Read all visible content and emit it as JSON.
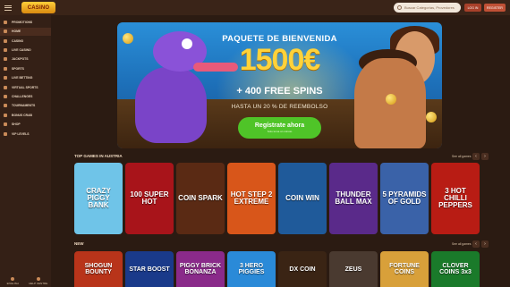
{
  "header": {
    "logo_text": "CASINO",
    "search_placeholder": "Buscar Categorías, Provedores",
    "login_label": "LOG IN",
    "register_label": "REGISTER"
  },
  "sidebar": {
    "items": [
      {
        "label": "PROMOTIONS",
        "icon": "gift-icon",
        "active": false
      },
      {
        "label": "HOME",
        "icon": "home-icon",
        "active": true
      },
      {
        "label": "CASINO",
        "icon": "cards-icon",
        "active": false
      },
      {
        "label": "LIVE CASINO",
        "icon": "live-icon",
        "active": false
      },
      {
        "label": "JACKPOTS",
        "icon": "trophy-icon",
        "active": false
      },
      {
        "label": "SPORTS",
        "icon": "ball-icon",
        "active": false
      },
      {
        "label": "LIVE BETTING",
        "icon": "live-bet-icon",
        "active": false
      },
      {
        "label": "VIRTUAL SPORTS",
        "icon": "virtual-icon",
        "active": false
      },
      {
        "label": "CHALLENGES",
        "icon": "target-icon",
        "active": false
      },
      {
        "label": "TOURNAMENTS",
        "icon": "cup-icon",
        "active": false
      },
      {
        "label": "BONUS CRAB",
        "icon": "crab-icon",
        "active": false
      },
      {
        "label": "SHOP",
        "icon": "shop-icon",
        "active": false
      },
      {
        "label": "VIP LEVELS",
        "icon": "crown-icon",
        "active": false
      }
    ],
    "bottom": [
      {
        "label": "ENGLISH",
        "icon": "globe-icon"
      },
      {
        "label": "HELP CENTRE",
        "icon": "help-icon"
      }
    ]
  },
  "banner": {
    "title": "PAQUETE DE BIENVENIDA",
    "amount": "1500€",
    "spins": "+ 400 FREE SPINS",
    "cashback": "HASTA UN 20 % DE REEMBOLSO",
    "cta": "Regístrate ahora",
    "cta_sub": "Solo toma un minuto"
  },
  "sections": {
    "top": {
      "title": "TOP GAMES IN AUSTRIA",
      "see_all": "See all games",
      "games": [
        {
          "name": "CRAZY PIGGY BANK",
          "bg": "#6fc4e8",
          "provider": ""
        },
        {
          "name": "100 SUPER HOT",
          "bg": "#a8141a",
          "provider": ""
        },
        {
          "name": "COIN SPARK",
          "bg": "#5a2a14",
          "provider": ""
        },
        {
          "name": "HOT STEP 2 EXTREME",
          "bg": "#d8561a",
          "provider": ""
        },
        {
          "name": "COIN WIN",
          "bg": "#1f5a9a",
          "provider": ""
        },
        {
          "name": "THUNDER BALL MAX",
          "bg": "#5a2a8a",
          "provider": ""
        },
        {
          "name": "5 PYRAMIDS OF GOLD",
          "bg": "#3a62a8",
          "provider": ""
        },
        {
          "name": "3 HOT CHILLI PEPPERS",
          "bg": "#b81c14",
          "provider": ""
        }
      ]
    },
    "new": {
      "title": "NEW",
      "see_all": "See all games",
      "games": [
        {
          "name": "SHOGUN BOUNTY",
          "bg": "#b8341a"
        },
        {
          "name": "STAR BOOST",
          "bg": "#1a3a8a"
        },
        {
          "name": "PIGGY BRICK BONANZA",
          "bg": "#8a2a8a"
        },
        {
          "name": "3 HERO PIGGIES",
          "bg": "#2a8ad8"
        },
        {
          "name": "DX COIN",
          "bg": "#3a2414"
        },
        {
          "name": "ZEUS",
          "bg": "#4a3a30"
        },
        {
          "name": "FORTUNE COINS",
          "bg": "#d8a03a"
        },
        {
          "name": "CLOVER COINS 3x3",
          "bg": "#1a7a2a"
        }
      ]
    }
  },
  "colors": {
    "bg": "#2b1b12",
    "accent": "#c05035",
    "cta": "#4fc428",
    "gold": "#ffd23a"
  }
}
